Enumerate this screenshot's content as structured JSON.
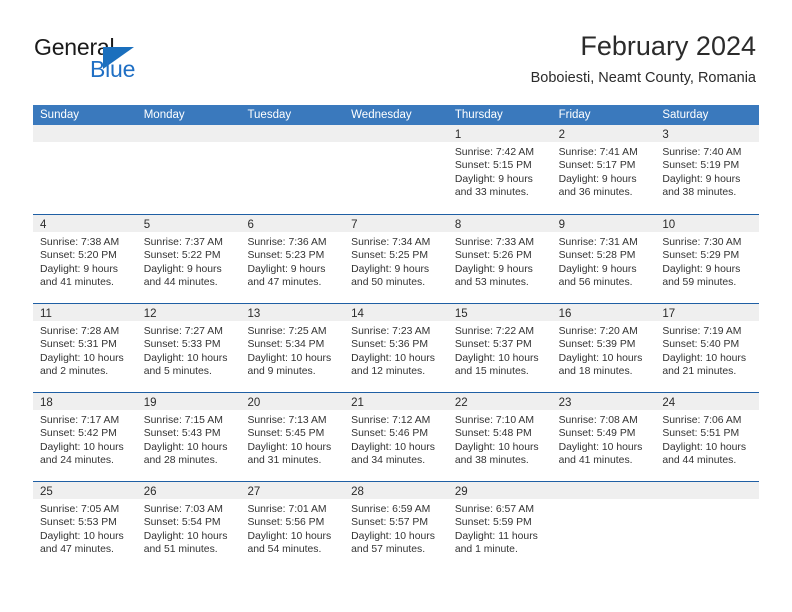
{
  "brand": {
    "word_one": "General",
    "word_two": "Blue",
    "triangle_icon": "blue-triangle-icon"
  },
  "header": {
    "title": "February 2024",
    "location": "Boboiesti, Neamt County, Romania"
  },
  "colors": {
    "header_blue": "#3a79bd",
    "row_divider_blue": "#1f5fa4",
    "day_band_gray": "#efefef",
    "brand_blue": "#1f6fc4",
    "text": "#2b2b2b"
  },
  "weekdays": [
    "Sunday",
    "Monday",
    "Tuesday",
    "Wednesday",
    "Thursday",
    "Friday",
    "Saturday"
  ],
  "weeks": [
    [
      {
        "day": "",
        "empty": true
      },
      {
        "day": "",
        "empty": true
      },
      {
        "day": "",
        "empty": true
      },
      {
        "day": "",
        "empty": true
      },
      {
        "day": "1",
        "sunrise": "Sunrise: 7:42 AM",
        "sunset": "Sunset: 5:15 PM",
        "daylight_1": "Daylight: 9 hours",
        "daylight_2": "and 33 minutes."
      },
      {
        "day": "2",
        "sunrise": "Sunrise: 7:41 AM",
        "sunset": "Sunset: 5:17 PM",
        "daylight_1": "Daylight: 9 hours",
        "daylight_2": "and 36 minutes."
      },
      {
        "day": "3",
        "sunrise": "Sunrise: 7:40 AM",
        "sunset": "Sunset: 5:19 PM",
        "daylight_1": "Daylight: 9 hours",
        "daylight_2": "and 38 minutes."
      }
    ],
    [
      {
        "day": "4",
        "sunrise": "Sunrise: 7:38 AM",
        "sunset": "Sunset: 5:20 PM",
        "daylight_1": "Daylight: 9 hours",
        "daylight_2": "and 41 minutes."
      },
      {
        "day": "5",
        "sunrise": "Sunrise: 7:37 AM",
        "sunset": "Sunset: 5:22 PM",
        "daylight_1": "Daylight: 9 hours",
        "daylight_2": "and 44 minutes."
      },
      {
        "day": "6",
        "sunrise": "Sunrise: 7:36 AM",
        "sunset": "Sunset: 5:23 PM",
        "daylight_1": "Daylight: 9 hours",
        "daylight_2": "and 47 minutes."
      },
      {
        "day": "7",
        "sunrise": "Sunrise: 7:34 AM",
        "sunset": "Sunset: 5:25 PM",
        "daylight_1": "Daylight: 9 hours",
        "daylight_2": "and 50 minutes."
      },
      {
        "day": "8",
        "sunrise": "Sunrise: 7:33 AM",
        "sunset": "Sunset: 5:26 PM",
        "daylight_1": "Daylight: 9 hours",
        "daylight_2": "and 53 minutes."
      },
      {
        "day": "9",
        "sunrise": "Sunrise: 7:31 AM",
        "sunset": "Sunset: 5:28 PM",
        "daylight_1": "Daylight: 9 hours",
        "daylight_2": "and 56 minutes."
      },
      {
        "day": "10",
        "sunrise": "Sunrise: 7:30 AM",
        "sunset": "Sunset: 5:29 PM",
        "daylight_1": "Daylight: 9 hours",
        "daylight_2": "and 59 minutes."
      }
    ],
    [
      {
        "day": "11",
        "sunrise": "Sunrise: 7:28 AM",
        "sunset": "Sunset: 5:31 PM",
        "daylight_1": "Daylight: 10 hours",
        "daylight_2": "and 2 minutes."
      },
      {
        "day": "12",
        "sunrise": "Sunrise: 7:27 AM",
        "sunset": "Sunset: 5:33 PM",
        "daylight_1": "Daylight: 10 hours",
        "daylight_2": "and 5 minutes."
      },
      {
        "day": "13",
        "sunrise": "Sunrise: 7:25 AM",
        "sunset": "Sunset: 5:34 PM",
        "daylight_1": "Daylight: 10 hours",
        "daylight_2": "and 9 minutes."
      },
      {
        "day": "14",
        "sunrise": "Sunrise: 7:23 AM",
        "sunset": "Sunset: 5:36 PM",
        "daylight_1": "Daylight: 10 hours",
        "daylight_2": "and 12 minutes."
      },
      {
        "day": "15",
        "sunrise": "Sunrise: 7:22 AM",
        "sunset": "Sunset: 5:37 PM",
        "daylight_1": "Daylight: 10 hours",
        "daylight_2": "and 15 minutes."
      },
      {
        "day": "16",
        "sunrise": "Sunrise: 7:20 AM",
        "sunset": "Sunset: 5:39 PM",
        "daylight_1": "Daylight: 10 hours",
        "daylight_2": "and 18 minutes."
      },
      {
        "day": "17",
        "sunrise": "Sunrise: 7:19 AM",
        "sunset": "Sunset: 5:40 PM",
        "daylight_1": "Daylight: 10 hours",
        "daylight_2": "and 21 minutes."
      }
    ],
    [
      {
        "day": "18",
        "sunrise": "Sunrise: 7:17 AM",
        "sunset": "Sunset: 5:42 PM",
        "daylight_1": "Daylight: 10 hours",
        "daylight_2": "and 24 minutes."
      },
      {
        "day": "19",
        "sunrise": "Sunrise: 7:15 AM",
        "sunset": "Sunset: 5:43 PM",
        "daylight_1": "Daylight: 10 hours",
        "daylight_2": "and 28 minutes."
      },
      {
        "day": "20",
        "sunrise": "Sunrise: 7:13 AM",
        "sunset": "Sunset: 5:45 PM",
        "daylight_1": "Daylight: 10 hours",
        "daylight_2": "and 31 minutes."
      },
      {
        "day": "21",
        "sunrise": "Sunrise: 7:12 AM",
        "sunset": "Sunset: 5:46 PM",
        "daylight_1": "Daylight: 10 hours",
        "daylight_2": "and 34 minutes."
      },
      {
        "day": "22",
        "sunrise": "Sunrise: 7:10 AM",
        "sunset": "Sunset: 5:48 PM",
        "daylight_1": "Daylight: 10 hours",
        "daylight_2": "and 38 minutes."
      },
      {
        "day": "23",
        "sunrise": "Sunrise: 7:08 AM",
        "sunset": "Sunset: 5:49 PM",
        "daylight_1": "Daylight: 10 hours",
        "daylight_2": "and 41 minutes."
      },
      {
        "day": "24",
        "sunrise": "Sunrise: 7:06 AM",
        "sunset": "Sunset: 5:51 PM",
        "daylight_1": "Daylight: 10 hours",
        "daylight_2": "and 44 minutes."
      }
    ],
    [
      {
        "day": "25",
        "sunrise": "Sunrise: 7:05 AM",
        "sunset": "Sunset: 5:53 PM",
        "daylight_1": "Daylight: 10 hours",
        "daylight_2": "and 47 minutes."
      },
      {
        "day": "26",
        "sunrise": "Sunrise: 7:03 AM",
        "sunset": "Sunset: 5:54 PM",
        "daylight_1": "Daylight: 10 hours",
        "daylight_2": "and 51 minutes."
      },
      {
        "day": "27",
        "sunrise": "Sunrise: 7:01 AM",
        "sunset": "Sunset: 5:56 PM",
        "daylight_1": "Daylight: 10 hours",
        "daylight_2": "and 54 minutes."
      },
      {
        "day": "28",
        "sunrise": "Sunrise: 6:59 AM",
        "sunset": "Sunset: 5:57 PM",
        "daylight_1": "Daylight: 10 hours",
        "daylight_2": "and 57 minutes."
      },
      {
        "day": "29",
        "sunrise": "Sunrise: 6:57 AM",
        "sunset": "Sunset: 5:59 PM",
        "daylight_1": "Daylight: 11 hours",
        "daylight_2": "and 1 minute."
      },
      {
        "day": "",
        "empty": true
      },
      {
        "day": "",
        "empty": true
      }
    ]
  ]
}
